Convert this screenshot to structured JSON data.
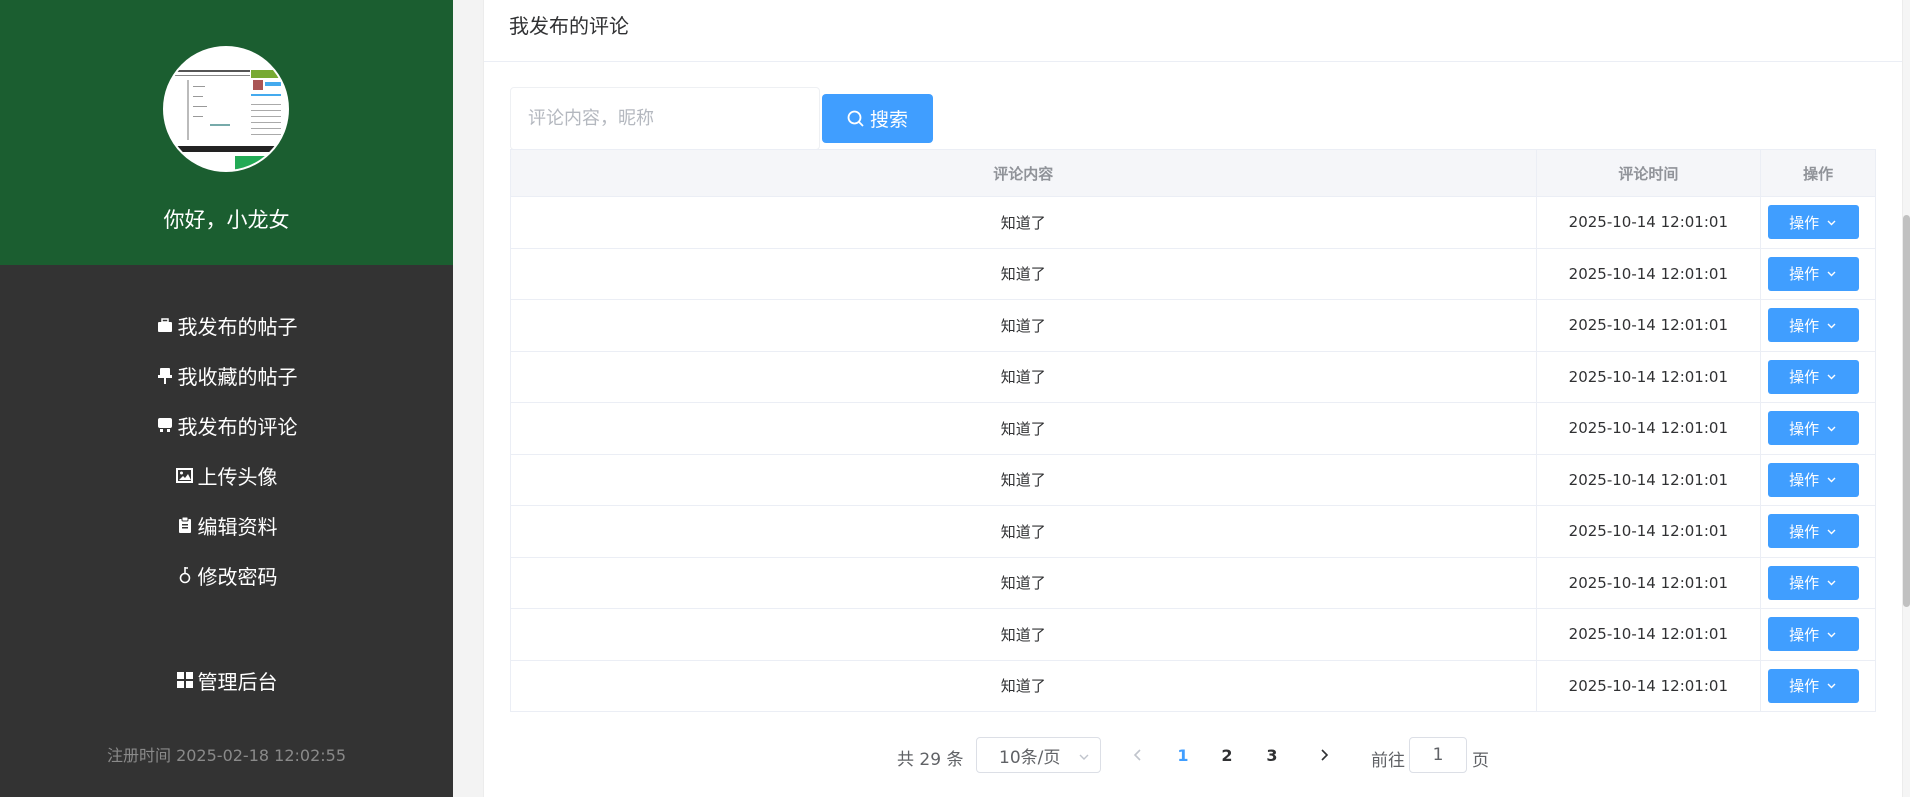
{
  "sidebar": {
    "greeting": "你好，小龙女",
    "menu": [
      {
        "label": "我发布的帖子",
        "icon": "briefcase-icon"
      },
      {
        "label": "我收藏的帖子",
        "icon": "pin-icon"
      },
      {
        "label": "我发布的评论",
        "icon": "comment-icon"
      },
      {
        "label": "上传头像",
        "icon": "image-icon"
      },
      {
        "label": "编辑资料",
        "icon": "clipboard-icon"
      },
      {
        "label": "修改密码",
        "icon": "key-icon"
      }
    ],
    "admin_label": "管理后台",
    "admin_icon": "grid-icon",
    "register_time": "注册时间 2025-02-18 12:02:55"
  },
  "main": {
    "title": "我发布的评论",
    "search": {
      "placeholder": "评论内容，昵称",
      "button_label": "搜索"
    },
    "table": {
      "columns": [
        "评论内容",
        "评论时间",
        "操作"
      ],
      "rows": [
        {
          "content": "知道了",
          "time": "2025-10-14 12:01:01",
          "action": "操作"
        },
        {
          "content": "知道了",
          "time": "2025-10-14 12:01:01",
          "action": "操作"
        },
        {
          "content": "知道了",
          "time": "2025-10-14 12:01:01",
          "action": "操作"
        },
        {
          "content": "知道了",
          "time": "2025-10-14 12:01:01",
          "action": "操作"
        },
        {
          "content": "知道了",
          "time": "2025-10-14 12:01:01",
          "action": "操作"
        },
        {
          "content": "知道了",
          "time": "2025-10-14 12:01:01",
          "action": "操作"
        },
        {
          "content": "知道了",
          "time": "2025-10-14 12:01:01",
          "action": "操作"
        },
        {
          "content": "知道了",
          "time": "2025-10-14 12:01:01",
          "action": "操作"
        },
        {
          "content": "知道了",
          "time": "2025-10-14 12:01:01",
          "action": "操作"
        },
        {
          "content": "知道了",
          "time": "2025-10-14 12:01:01",
          "action": "操作"
        }
      ]
    },
    "pagination": {
      "total": "共 29 条",
      "page_size": "10条/页",
      "pages": [
        "1",
        "2",
        "3"
      ],
      "current_page": "1",
      "goto_label": "前往",
      "goto_value": "1",
      "page_suffix": "页"
    }
  },
  "colors": {
    "sidebar_profile": "#1b5e30",
    "sidebar_bg": "#333333",
    "primary": "#409eff"
  }
}
